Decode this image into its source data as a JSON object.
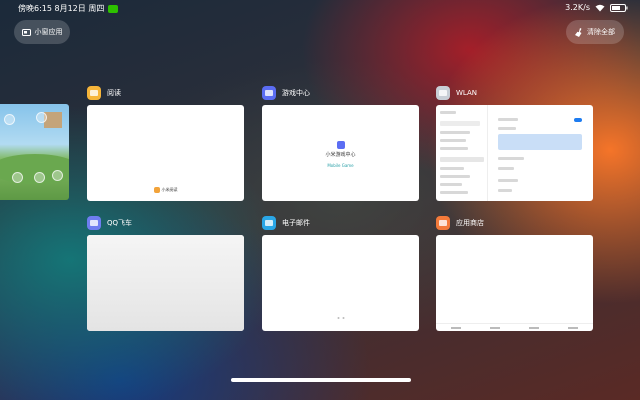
{
  "status_bar": {
    "time_date": "傍晚6:15  8月12日  周四",
    "net_speed": "3.2K/s",
    "battery": "54"
  },
  "buttons": {
    "small_window": "小窗应用",
    "clear_all": "清除全部"
  },
  "apps": [
    {
      "name": "阅读",
      "icon": "book-icon",
      "color": "#f6b53a"
    },
    {
      "name": "游戏中心",
      "icon": "game-center-icon",
      "color": "#5b6df3",
      "thumb_title": "小米游戏中心",
      "thumb_sub": "Mobile Game"
    },
    {
      "name": "WLAN",
      "icon": "settings-gear-icon",
      "color": "#c8ced6"
    },
    {
      "name": "QQ飞车",
      "icon": "qq-speed-icon",
      "color": "#6f7df0"
    },
    {
      "name": "电子邮件",
      "icon": "email-icon",
      "color": "#2aa6e6"
    },
    {
      "name": "应用商店",
      "icon": "app-store-icon",
      "color": "#f37a3a"
    }
  ],
  "reading_thumb_logo": "小米阅读"
}
